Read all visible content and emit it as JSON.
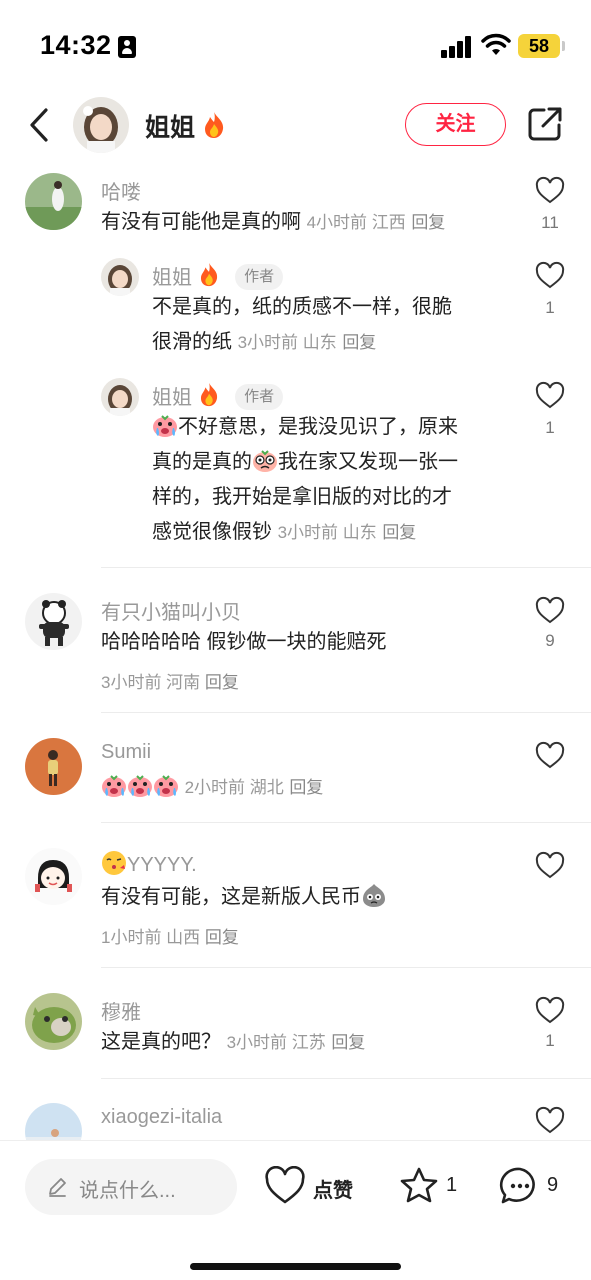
{
  "status": {
    "time": "14:32",
    "battery": "58"
  },
  "header": {
    "name": "姐姐",
    "follow_label": "关注"
  },
  "comments": [
    {
      "user": "哈喽",
      "text": "有没有可能他是真的啊",
      "meta": "4小时前 江西",
      "reply": "回复",
      "likes": "11"
    },
    {
      "user": "姐姐",
      "tag": "作者",
      "text_l1": "不是真的，纸的质感不一样，很脆",
      "text_l2": "很滑的纸",
      "meta": "3小时前 山东",
      "reply": "回复",
      "likes": "1"
    },
    {
      "user": "姐姐",
      "tag": "作者",
      "text_l1": "不好意思，是我没见识了，原来",
      "text_l2a": "真的是真的",
      "text_l2b": "我在家又发现一张一",
      "text_l3": "样的，我开始是拿旧版的对比的才",
      "text_l4": "感觉很像假钞",
      "meta": "3小时前 山东",
      "reply": "回复",
      "likes": "1"
    },
    {
      "user": "有只小猫叫小贝",
      "text": "哈哈哈哈哈 假钞做一块的能赔死",
      "meta": "3小时前 河南",
      "reply": "回复",
      "likes": "9"
    },
    {
      "user": "Sumii",
      "meta": "2小时前 湖北",
      "reply": "回复",
      "likes": ""
    },
    {
      "user": "YYYYY.",
      "text": "有没有可能，这是新版人民币",
      "meta": "1小时前 山西",
      "reply": "回复",
      "likes": ""
    },
    {
      "user": "穆雅",
      "text": "这是真的吧？",
      "meta": "3小时前 江苏",
      "reply": "回复",
      "likes": "1"
    },
    {
      "user": "xiaogezi-italia",
      "likes": ""
    }
  ],
  "bottom": {
    "placeholder": "说点什么...",
    "like_label": "点赞",
    "star_count": "1",
    "comment_count": "9"
  },
  "colors": {
    "accent": "#ff2442",
    "battery": "#f5d33a"
  },
  "icons": [
    "back-arrow-icon",
    "share-icon",
    "heart-icon",
    "star-icon",
    "comment-bubble-icon",
    "pencil-icon",
    "fire-emoji-icon",
    "crying-emoji-icon",
    "nervous-emoji-icon",
    "kiss-emoji-icon",
    "sad-blob-emoji-icon"
  ]
}
